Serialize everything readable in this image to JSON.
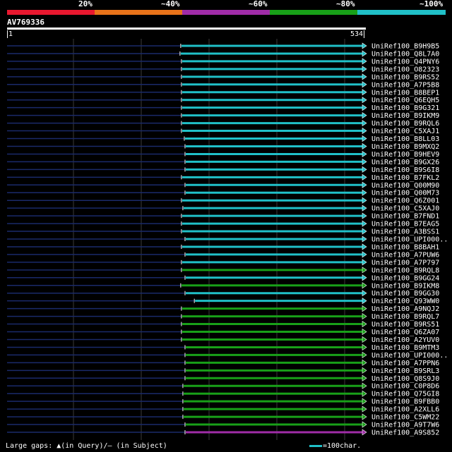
{
  "legend": {
    "labels": [
      "20%",
      "~40%",
      "~60%",
      "~80%",
      "~100%"
    ],
    "colors": [
      "#e8182f",
      "#e8731a",
      "#a02ca8",
      "#18a018",
      "#20c0c8"
    ]
  },
  "query": {
    "name": "AV769336",
    "start": "1",
    "end": "534"
  },
  "footer": {
    "gaps_text": "Large gaps: ▲(in Query)/– (in Subject)",
    "scale_text": "=100char."
  },
  "hits": [
    {
      "name": "UniRef100_B9H9B5",
      "start": 0.484,
      "color": "cyan"
    },
    {
      "name": "UniRef100_Q8L7A0",
      "start": 0.482,
      "color": "cyan"
    },
    {
      "name": "UniRef100_Q4PNY6",
      "start": 0.486,
      "color": "cyan"
    },
    {
      "name": "UniRef100_O82323",
      "start": 0.486,
      "color": "cyan"
    },
    {
      "name": "UniRef100_B9RS52",
      "start": 0.486,
      "color": "cyan"
    },
    {
      "name": "UniRef100_A7P5B8",
      "start": 0.486,
      "color": "cyan"
    },
    {
      "name": "UniRef100_B8BEP1",
      "start": 0.486,
      "color": "cyan"
    },
    {
      "name": "UniRef100_Q6EQH5",
      "start": 0.486,
      "color": "cyan"
    },
    {
      "name": "UniRef100_B9G321",
      "start": 0.486,
      "color": "cyan"
    },
    {
      "name": "UniRef100_B9IKM9",
      "start": 0.486,
      "color": "cyan"
    },
    {
      "name": "UniRef100_B9RQL6",
      "start": 0.486,
      "color": "cyan"
    },
    {
      "name": "UniRef100_C5XAJ1",
      "start": 0.486,
      "color": "cyan"
    },
    {
      "name": "UniRef100_B8LL03",
      "start": 0.494,
      "color": "cyan"
    },
    {
      "name": "UniRef100_B9MXQ2",
      "start": 0.496,
      "color": "cyan"
    },
    {
      "name": "UniRef100_B9HEV9",
      "start": 0.496,
      "color": "cyan"
    },
    {
      "name": "UniRef100_B9GX26",
      "start": 0.496,
      "color": "cyan"
    },
    {
      "name": "UniRef100_B9S6I8",
      "start": 0.496,
      "color": "cyan"
    },
    {
      "name": "UniRef100_B7FKL2",
      "start": 0.486,
      "color": "cyan"
    },
    {
      "name": "UniRef100_Q00M90",
      "start": 0.496,
      "color": "cyan"
    },
    {
      "name": "UniRef100_Q00M73",
      "start": 0.496,
      "color": "cyan"
    },
    {
      "name": "UniRef100_Q6Z001",
      "start": 0.486,
      "color": "cyan"
    },
    {
      "name": "UniRef100_C5XAJ0",
      "start": 0.49,
      "color": "cyan"
    },
    {
      "name": "UniRef100_B7FND1",
      "start": 0.486,
      "color": "cyan"
    },
    {
      "name": "UniRef100_B7EAG5",
      "start": 0.486,
      "color": "cyan"
    },
    {
      "name": "UniRef100_A3BSS1",
      "start": 0.486,
      "color": "cyan"
    },
    {
      "name": "UniRef100_UPI000..",
      "start": 0.496,
      "color": "cyan"
    },
    {
      "name": "UniRef100_B8BAH1",
      "start": 0.486,
      "color": "cyan"
    },
    {
      "name": "UniRef100_A7PUW6",
      "start": 0.496,
      "color": "cyan"
    },
    {
      "name": "UniRef100_A7P797",
      "start": 0.486,
      "color": "cyan"
    },
    {
      "name": "UniRef100_B9RQL8",
      "start": 0.486,
      "color": "green"
    },
    {
      "name": "UniRef100_B9GG24",
      "start": 0.496,
      "color": "cyan"
    },
    {
      "name": "UniRef100_B9IKM8",
      "start": 0.484,
      "color": "green"
    },
    {
      "name": "UniRef100_B9GG30",
      "start": 0.496,
      "color": "cyan"
    },
    {
      "name": "UniRef100_Q93WW0",
      "start": 0.522,
      "color": "cyan"
    },
    {
      "name": "UniRef100_A9NQJ2",
      "start": 0.486,
      "color": "green"
    },
    {
      "name": "UniRef100_B9RQL7",
      "start": 0.486,
      "color": "green"
    },
    {
      "name": "UniRef100_B9RS51",
      "start": 0.486,
      "color": "green"
    },
    {
      "name": "UniRef100_Q6ZA07",
      "start": 0.486,
      "color": "green"
    },
    {
      "name": "UniRef100_A2YUV0",
      "start": 0.486,
      "color": "green"
    },
    {
      "name": "UniRef100_B9MTM3",
      "start": 0.496,
      "color": "green"
    },
    {
      "name": "UniRef100_UPI000..",
      "start": 0.496,
      "color": "green"
    },
    {
      "name": "UniRef100_A7PPN6",
      "start": 0.496,
      "color": "green"
    },
    {
      "name": "UniRef100_B9SRL3",
      "start": 0.496,
      "color": "green"
    },
    {
      "name": "UniRef100_Q8S9J0",
      "start": 0.496,
      "color": "green"
    },
    {
      "name": "UniRef100_C0P8D6",
      "start": 0.49,
      "color": "green"
    },
    {
      "name": "UniRef100_Q75GI8",
      "start": 0.49,
      "color": "green"
    },
    {
      "name": "UniRef100_B9FBB0",
      "start": 0.49,
      "color": "green"
    },
    {
      "name": "UniRef100_A2XLL6",
      "start": 0.49,
      "color": "green"
    },
    {
      "name": "UniRef100_C5WM22",
      "start": 0.49,
      "color": "green"
    },
    {
      "name": "UniRef100_A9T7W6",
      "start": 0.496,
      "color": "green"
    },
    {
      "name": "UniRef100_A9S852",
      "start": 0.496,
      "color": "purple"
    }
  ]
}
